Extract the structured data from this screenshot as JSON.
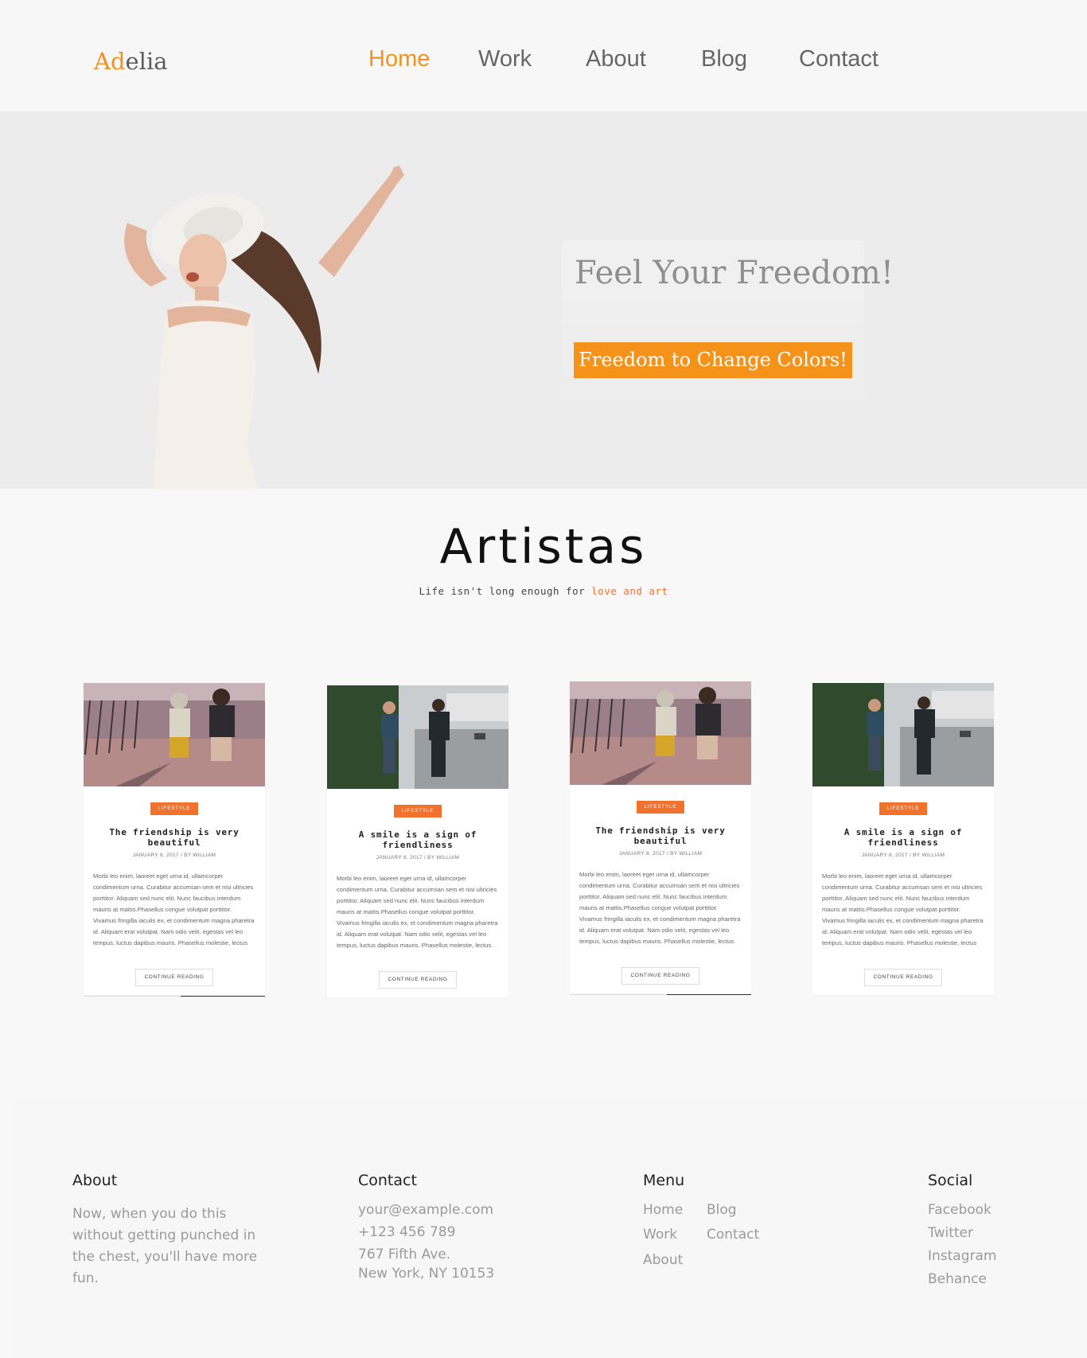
{
  "brand": {
    "logo_part1": "Ad",
    "logo_part2": "elia",
    "accent": "#f0931f"
  },
  "nav": {
    "items": [
      {
        "label": "Home",
        "active": true
      },
      {
        "label": "Work"
      },
      {
        "label": "About"
      },
      {
        "label": "Blog"
      },
      {
        "label": "Contact"
      }
    ]
  },
  "hero": {
    "title": "Feel Your Freedom!",
    "button": "Freedom to Change Colors!",
    "button_color": "#f49219"
  },
  "section": {
    "title": "Artistas",
    "subtitle_prefix": "Life isn't long enough for ",
    "subtitle_highlight": "love and art",
    "highlight_color": "#f0722d"
  },
  "cards": [
    {
      "badge": "LIFESTYLE",
      "title": "The friendship is very beautiful",
      "date": "JANUARY 8, 2017",
      "separator": "/",
      "author": "BY WILLIAM",
      "text": "Morbi leo enim, laoreet eget urna id, ullamcorper condimentum urna. Curabitur accumsan sem et nisi ultricies porttitor. Aliquam sed nunc elit. Nunc faucibus interdum mauris at mattis.Phasellus congue volutpat porttitor. Vivamus fringilla iaculis ex, et condimentum magna pharetra id. Aliquam erat volutpat. Nam odio velit, egestas vel leo tempus, luctus dapibus mauris. Phasellus molestie, lectus",
      "more": "CONTINUE READING",
      "image": "kids-walking-icon"
    },
    {
      "badge": "LIFESTYLE",
      "title": "A smile is a sign of friendliness",
      "date": "JANUARY 8, 2017",
      "separator": "/",
      "author": "BY WILLIAM",
      "text": "Morbi leo enim, laoreet eget urna id, ullamcorper condimentum urna. Curabitur accumsan sem et nisi ultricies porttitor. Aliquam sed nunc elit. Nunc faucibus interdum mauris at mattis.Phasellus congue volutpat porttitor. Vivamus fringilla iaculis ex, et condimentum magna pharetra id. Aliquam erat volutpat. Nam odio velit, egestas vel leo tempus, luctus dapibus mauris. Phasellus molestie, lectus",
      "more": "CONTINUE READING",
      "image": "couple-walking-icon"
    },
    {
      "badge": "LIFESTYLE",
      "title": "The friendship is very beautiful",
      "date": "JANUARY 8, 2017",
      "separator": "/",
      "author": "BY WILLIAM",
      "text": "Morbi leo enim, laoreet eget urna id, ullamcorper condimentum urna. Curabitur accumsan sem et nisi ultricies porttitor. Aliquam sed nunc elit. Nunc faucibus interdum mauris at mattis.Phasellus congue volutpat porttitor. Vivamus fringilla iaculis ex, et condimentum magna pharetra id. Aliquam erat volutpat. Nam odio velit, egestas vel leo tempus, luctus dapibus mauris. Phasellus molestie, lectus",
      "more": "CONTINUE READING",
      "image": "kids-walking-icon"
    },
    {
      "badge": "LIFESTYLE",
      "title": "A smile is a sign of friendliness",
      "date": "JANUARY 8, 2017",
      "separator": "/",
      "author": "BY WILLIAM",
      "text": "Morbi leo enim, laoreet eget urna id, ullamcorper condimentum urna. Curabitur accumsan sem et nisi ultricies porttitor. Aliquam sed nunc elit. Nunc faucibus interdum mauris at mattis.Phasellus congue volutpat porttitor. Vivamus fringilla iaculis ex, et condimentum magna pharetra id. Aliquam erat volutpat. Nam odio velit, egestas vel leo tempus, luctus dapibus mauris. Phasellus molestie, lectus",
      "more": "CONTINUE READING",
      "image": "couple-walking-icon"
    }
  ],
  "footer": {
    "about": {
      "heading": "About",
      "text": "Now, when you do this without getting punched in the chest, you'll have more fun."
    },
    "contact": {
      "heading": "Contact",
      "email": "your@example.com",
      "phone": "+123 456 789",
      "address1": "767 Fifth Ave.",
      "address2": "New York, NY 10153"
    },
    "menu": {
      "heading": "Menu",
      "items": [
        "Home",
        "Blog",
        "Work",
        "Contact",
        "About"
      ]
    },
    "social": {
      "heading": "Social",
      "items": [
        "Facebook",
        "Twitter",
        "Instagram",
        "Behance"
      ]
    }
  }
}
